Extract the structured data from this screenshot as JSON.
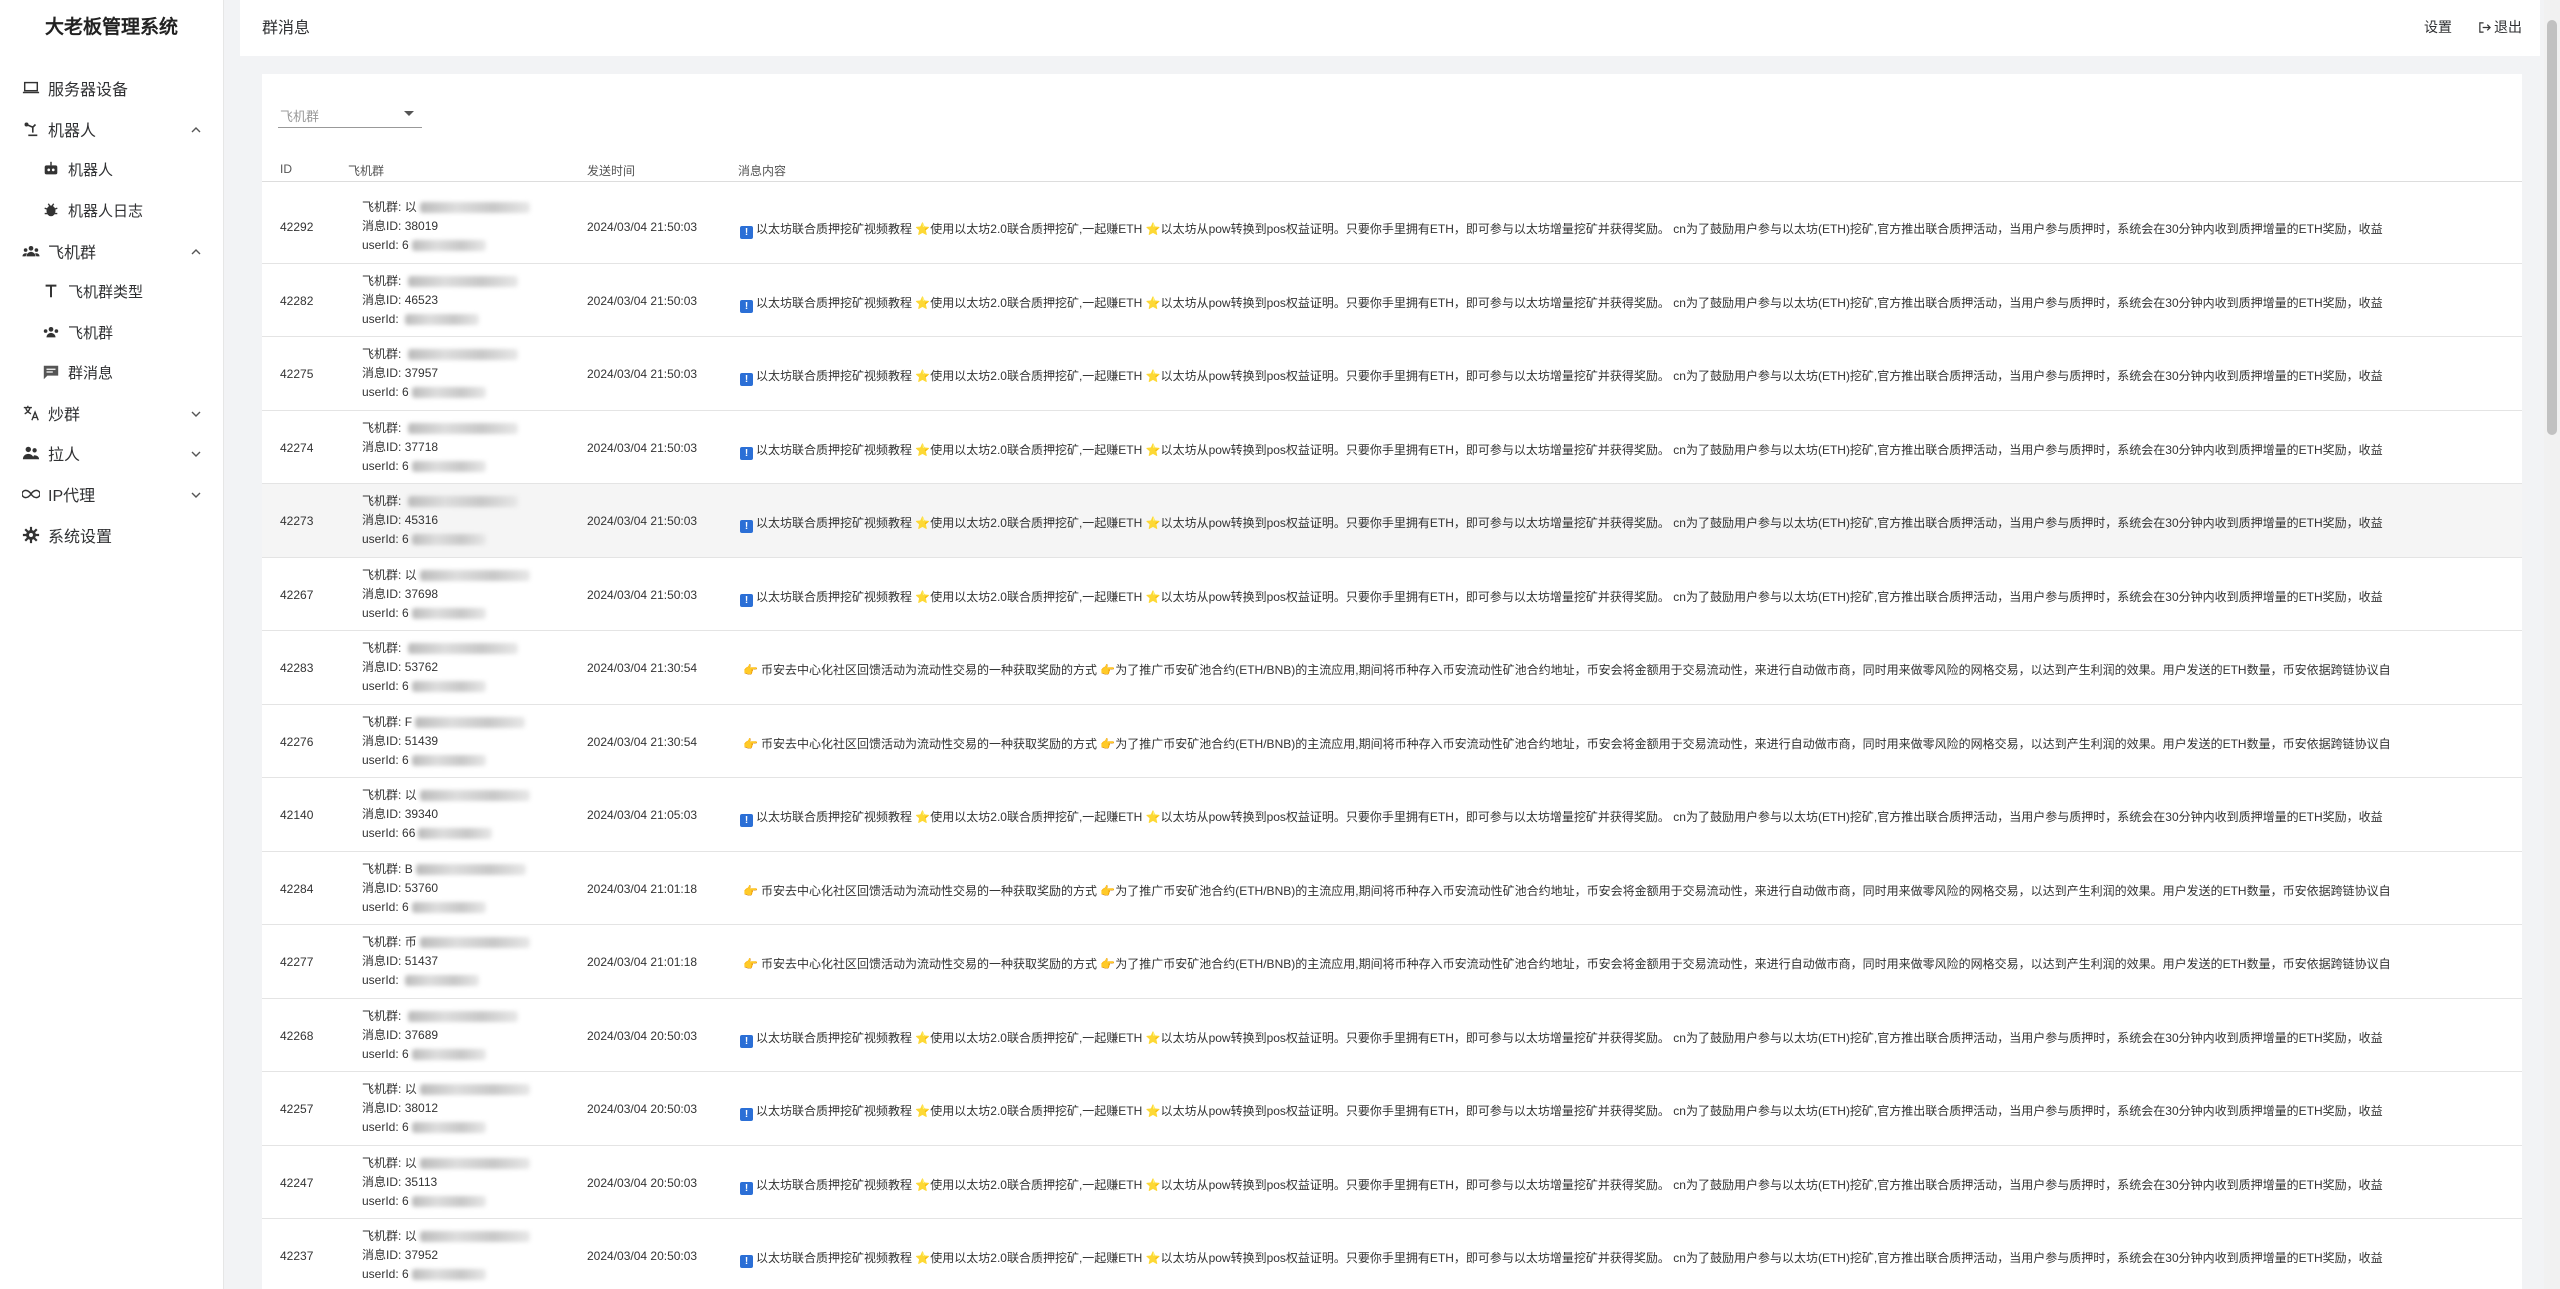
{
  "app": {
    "title": "大老板管理系统"
  },
  "sidebar": {
    "items": [
      {
        "label": "服务器设备",
        "icon": "laptop-icon"
      },
      {
        "label": "机器人",
        "icon": "robot-arm-icon",
        "expanded": true
      },
      {
        "label": "机器人",
        "icon": "robot-icon"
      },
      {
        "label": "机器人日志",
        "icon": "bug-icon"
      },
      {
        "label": "飞机群",
        "icon": "group-icon",
        "expanded": true
      },
      {
        "label": "飞机群类型",
        "icon": "text-type-icon"
      },
      {
        "label": "飞机群",
        "icon": "group-icon"
      },
      {
        "label": "群消息",
        "icon": "message-icon"
      },
      {
        "label": "炒群",
        "icon": "translate-icon",
        "expanded": false
      },
      {
        "label": "拉人",
        "icon": "users-icon",
        "expanded": false
      },
      {
        "label": "IP代理",
        "icon": "infinity-icon",
        "expanded": false
      },
      {
        "label": "系统设置",
        "icon": "gear-icon"
      }
    ]
  },
  "header": {
    "title": "群消息",
    "settings_label": "设置",
    "logout_label": "退出"
  },
  "filter": {
    "placeholder": "飞机群"
  },
  "table": {
    "columns": [
      "ID",
      "飞机群",
      "发送时间",
      "消息内容"
    ],
    "group_prefix": "飞机群:",
    "msgid_prefix": "消息ID:",
    "userid_prefix": "userId:",
    "msg_eth": "以太坊联合质押挖矿视频教程 ⭐使用以太坊2.0联合质押挖矿,一起赚ETH ⭐以太坊从pow转换到pos权益证明。只要你手里拥有ETH，即可参与以太坊增量挖矿并获得奖励。 cn为了鼓励用户参与以太坊(ETH)挖矿,官方推出联合质押活动，当用户参与质押时，系统会在30分钟内收到质押增量的ETH奖励，收益",
    "msg_bn": "币安去中心化社区回馈活动为流动性交易的一种获取奖励的方式 👉为了推广币安矿池合约(ETH/BNB)的主流应用,期间将币种存入币安流动性矿池合约地址，币安会将金额用于交易流动性，来进行自动做市商，同时用来做零风险的网格交易，以达到产生利润的效果。用户发送的ETH数量，币安依据跨链协议自",
    "rows": [
      {
        "id": "42292",
        "group": "以",
        "msg_id": "38019",
        "user_id": "6",
        "time": "2024/03/04 21:50:03",
        "type": "eth"
      },
      {
        "id": "42282",
        "group": "",
        "msg_id": "46523",
        "user_id": "",
        "time": "2024/03/04 21:50:03",
        "type": "eth"
      },
      {
        "id": "42275",
        "group": "",
        "msg_id": "37957",
        "user_id": "6",
        "time": "2024/03/04 21:50:03",
        "type": "eth"
      },
      {
        "id": "42274",
        "group": "",
        "msg_id": "37718",
        "user_id": "6",
        "time": "2024/03/04 21:50:03",
        "type": "eth"
      },
      {
        "id": "42273",
        "group": "",
        "msg_id": "45316",
        "user_id": "6",
        "time": "2024/03/04 21:50:03",
        "type": "eth"
      },
      {
        "id": "42267",
        "group": "以",
        "msg_id": "37698",
        "user_id": "6",
        "time": "2024/03/04 21:50:03",
        "type": "eth"
      },
      {
        "id": "42283",
        "group": "",
        "msg_id": "53762",
        "user_id": "6",
        "time": "2024/03/04 21:30:54",
        "type": "bn"
      },
      {
        "id": "42276",
        "group": "F",
        "msg_id": "51439",
        "user_id": "6",
        "time": "2024/03/04 21:30:54",
        "type": "bn"
      },
      {
        "id": "42140",
        "group": "以",
        "msg_id": "39340",
        "user_id": "66",
        "time": "2024/03/04 21:05:03",
        "type": "eth"
      },
      {
        "id": "42284",
        "group": "B",
        "msg_id": "53760",
        "user_id": "6",
        "time": "2024/03/04 21:01:18",
        "type": "bn"
      },
      {
        "id": "42277",
        "group": "币",
        "msg_id": "51437",
        "user_id": "",
        "time": "2024/03/04 21:01:18",
        "type": "bn"
      },
      {
        "id": "42268",
        "group": "",
        "msg_id": "37689",
        "user_id": "6",
        "time": "2024/03/04 20:50:03",
        "type": "eth"
      },
      {
        "id": "42257",
        "group": "以",
        "msg_id": "38012",
        "user_id": "6",
        "time": "2024/03/04 20:50:03",
        "type": "eth"
      },
      {
        "id": "42247",
        "group": "以",
        "msg_id": "35113",
        "user_id": "6",
        "time": "2024/03/04 20:50:03",
        "type": "eth"
      },
      {
        "id": "42237",
        "group": "以",
        "msg_id": "37952",
        "user_id": "6",
        "time": "2024/03/04 20:50:03",
        "type": "eth"
      }
    ]
  },
  "colors": {
    "badge": "#2b6fd6",
    "star": "#e5a700",
    "sidebar_bg": "#ffffff",
    "page_bg": "#f2f3f5"
  }
}
